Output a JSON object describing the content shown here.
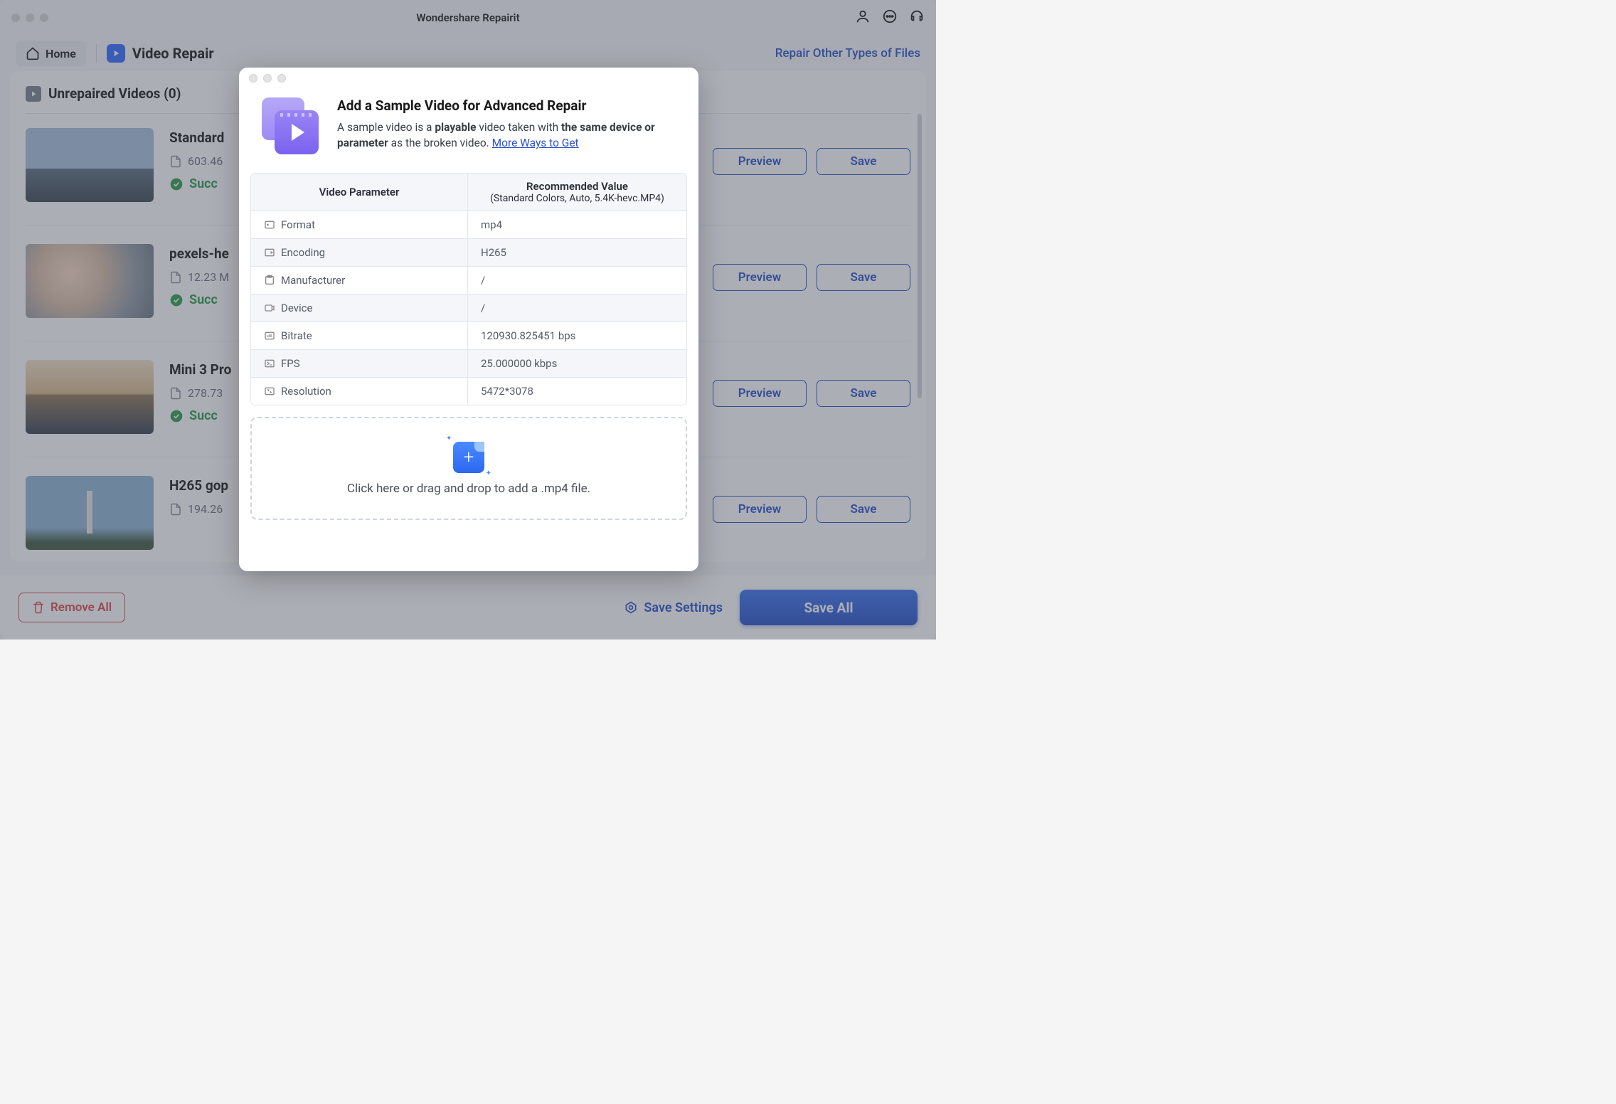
{
  "titlebar": {
    "title": "Wondershare Repairit"
  },
  "toolbar": {
    "home": "Home",
    "section": "Video Repair",
    "repair_other": "Repair Other Types of Files"
  },
  "content": {
    "header": "Unrepaired Videos (0)",
    "preview_label": "Preview",
    "save_label": "Save",
    "items": [
      {
        "name": "Standard",
        "size": "603.46",
        "status": "Succ"
      },
      {
        "name": "pexels-he",
        "size": "12.23 M",
        "status": "Succ"
      },
      {
        "name": "Mini 3 Pro",
        "size": "278.73",
        "status": "Succ"
      },
      {
        "name": "H265 gop",
        "size": "194.26",
        "status": ""
      }
    ]
  },
  "footer": {
    "remove_all": "Remove All",
    "save_settings": "Save Settings",
    "save_all": "Save All"
  },
  "modal": {
    "title": "Add a Sample Video for Advanced Repair",
    "desc_p1": "A sample video is a ",
    "desc_b1": "playable",
    "desc_p2": " video taken with ",
    "desc_b2": "the same device or parameter",
    "desc_p3": " as the broken video. ",
    "desc_link": "More Ways to Get",
    "table_header_left": "Video Parameter",
    "table_header_right_1": "Recommended Value",
    "table_header_right_2": "(Standard Colors, Auto, 5.4K-hevc.MP4)",
    "rows": [
      {
        "param": "Format",
        "value": "mp4"
      },
      {
        "param": "Encoding",
        "value": "H265"
      },
      {
        "param": "Manufacturer",
        "value": "/"
      },
      {
        "param": "Device",
        "value": "/"
      },
      {
        "param": "Bitrate",
        "value": "120930.825451 bps"
      },
      {
        "param": "FPS",
        "value": "25.000000 kbps"
      },
      {
        "param": "Resolution",
        "value": "5472*3078"
      }
    ],
    "drop_text": "Click here or drag and drop to add a .mp4 file."
  }
}
